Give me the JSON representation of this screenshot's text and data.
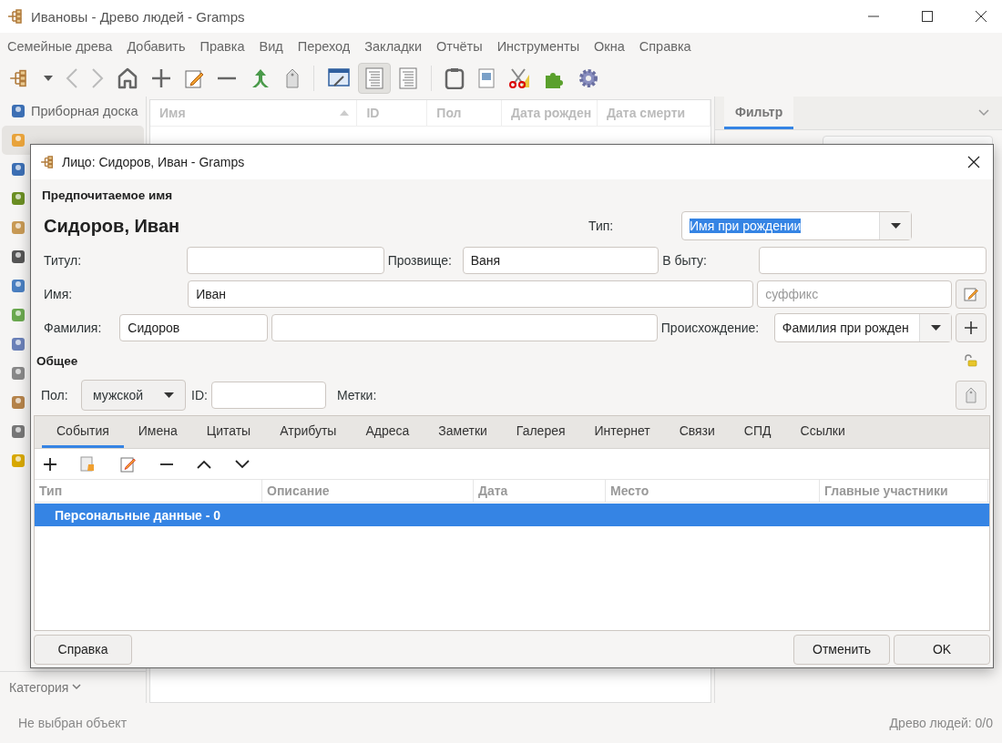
{
  "window": {
    "title": "Ивановы - Древо людей - Gramps"
  },
  "menu": [
    "Семейные древа",
    "Добавить",
    "Правка",
    "Вид",
    "Переход",
    "Закладки",
    "Отчёты",
    "Инструменты",
    "Окна",
    "Справка"
  ],
  "view_buttons": [
    {
      "selected": true
    },
    {
      "selected": false
    }
  ],
  "sidebar": {
    "items": [
      {
        "label": "Приборная доска",
        "selected": false
      },
      {
        "selected": true
      },
      {
        "selected": false
      },
      {
        "selected": false
      },
      {
        "selected": false
      },
      {
        "selected": false
      },
      {
        "selected": false
      },
      {
        "selected": false
      },
      {
        "selected": false
      },
      {
        "selected": false
      },
      {
        "selected": false
      },
      {
        "selected": false
      },
      {
        "selected": false
      }
    ],
    "category": "Категория"
  },
  "people_list": {
    "columns": [
      "Имя",
      "ID",
      "Пол",
      "Дата рожден",
      "Дата смерти"
    ]
  },
  "filter_panel": {
    "tabs": [
      {
        "label": "Фильтр",
        "selected": true
      }
    ]
  },
  "dialog": {
    "title": "Лицо: Сидоров, Иван - Gramps",
    "section_name": "Предпочитаемое имя",
    "full_name": "Сидоров, Иван",
    "type_label": "Тип:",
    "type_value": "Имя при рождении",
    "type_value_highlighted": true,
    "title_label": "Титул:",
    "nick_label": "Прозвище:",
    "nick_value": "Ваня",
    "call_label": "В быту:",
    "given_label": "Имя:",
    "given_value": "Иван",
    "suffix_placeholder": "суффикс",
    "surname_label": "Фамилия:",
    "surname_value": "Сидоров",
    "origin_label": "Происхождение:",
    "origin_value": "Фамилия при рожден",
    "general_section": "Общее",
    "gender_label": "Пол:",
    "gender_value": "мужской",
    "id_label": "ID:",
    "tags_label": "Метки:",
    "tabs": [
      {
        "label": "События",
        "selected": true
      },
      {
        "label": "Имена",
        "selected": false
      },
      {
        "label": "Цитаты",
        "selected": false
      },
      {
        "label": "Атрибуты",
        "selected": false
      },
      {
        "label": "Адреса",
        "selected": false
      },
      {
        "label": "Заметки",
        "selected": false
      },
      {
        "label": "Галерея",
        "selected": false
      },
      {
        "label": "Интернет",
        "selected": false
      },
      {
        "label": "Связи",
        "selected": false
      },
      {
        "label": "СПД",
        "selected": false
      },
      {
        "label": "Ссылки",
        "selected": false
      }
    ],
    "table": {
      "columns": [
        "Тип",
        "Описание",
        "Дата",
        "Место",
        "Главные участники"
      ],
      "rows": [
        {
          "label": "Персональные данные - 0",
          "selected": true
        }
      ]
    },
    "buttons": {
      "help": "Справка",
      "cancel": "Отменить",
      "ok": "OK"
    }
  },
  "status_bar": {
    "left": "Не выбран объект",
    "right": "Древо людей: 0/0"
  }
}
